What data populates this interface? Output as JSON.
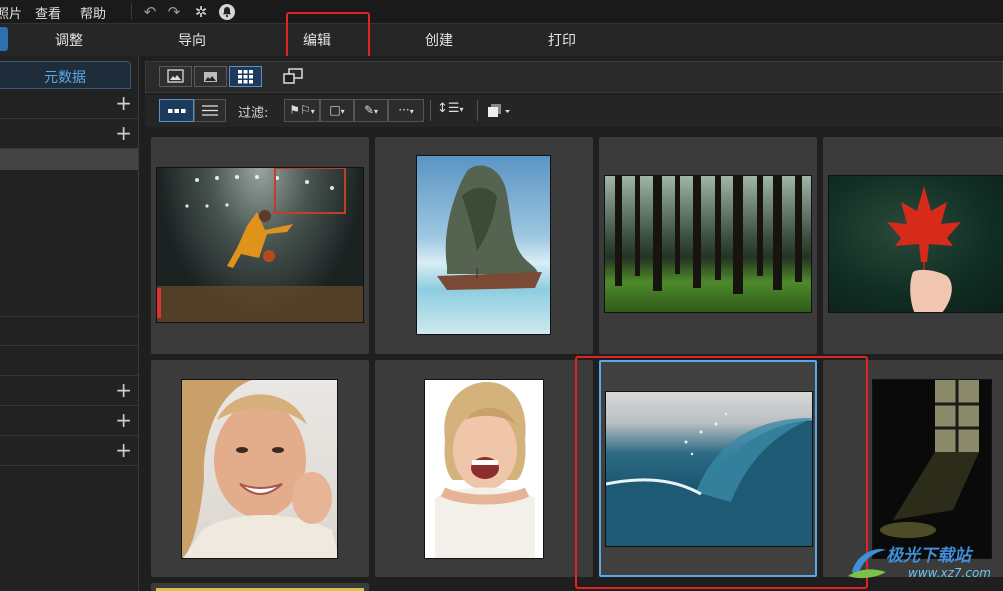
{
  "menubar": {
    "items": [
      "照片",
      "查看",
      "帮助"
    ]
  },
  "modules": {
    "tabs": [
      "调整",
      "导向",
      "编辑",
      "创建",
      "打印"
    ]
  },
  "left_panel": {
    "metadata_tab": "元数据"
  },
  "filter": {
    "label": "过滤:"
  },
  "watermark": {
    "text": "极光下载站",
    "url": "www.xz7.com"
  },
  "thumbnails": [
    {
      "subject": "basketball-player-dunk"
    },
    {
      "subject": "rock-island-boat"
    },
    {
      "subject": "forest-trees"
    },
    {
      "subject": "red-maple-leaf-hand"
    },
    {
      "subject": "smiling-woman"
    },
    {
      "subject": "laughing-blonde-woman"
    },
    {
      "subject": "ocean-wave",
      "selected": true
    },
    {
      "subject": "dark-window-room"
    }
  ],
  "colors": {
    "accent": "#5aa9e6",
    "highlight_box": "#e02424",
    "metadata_tab_text": "#5aa8e8"
  }
}
